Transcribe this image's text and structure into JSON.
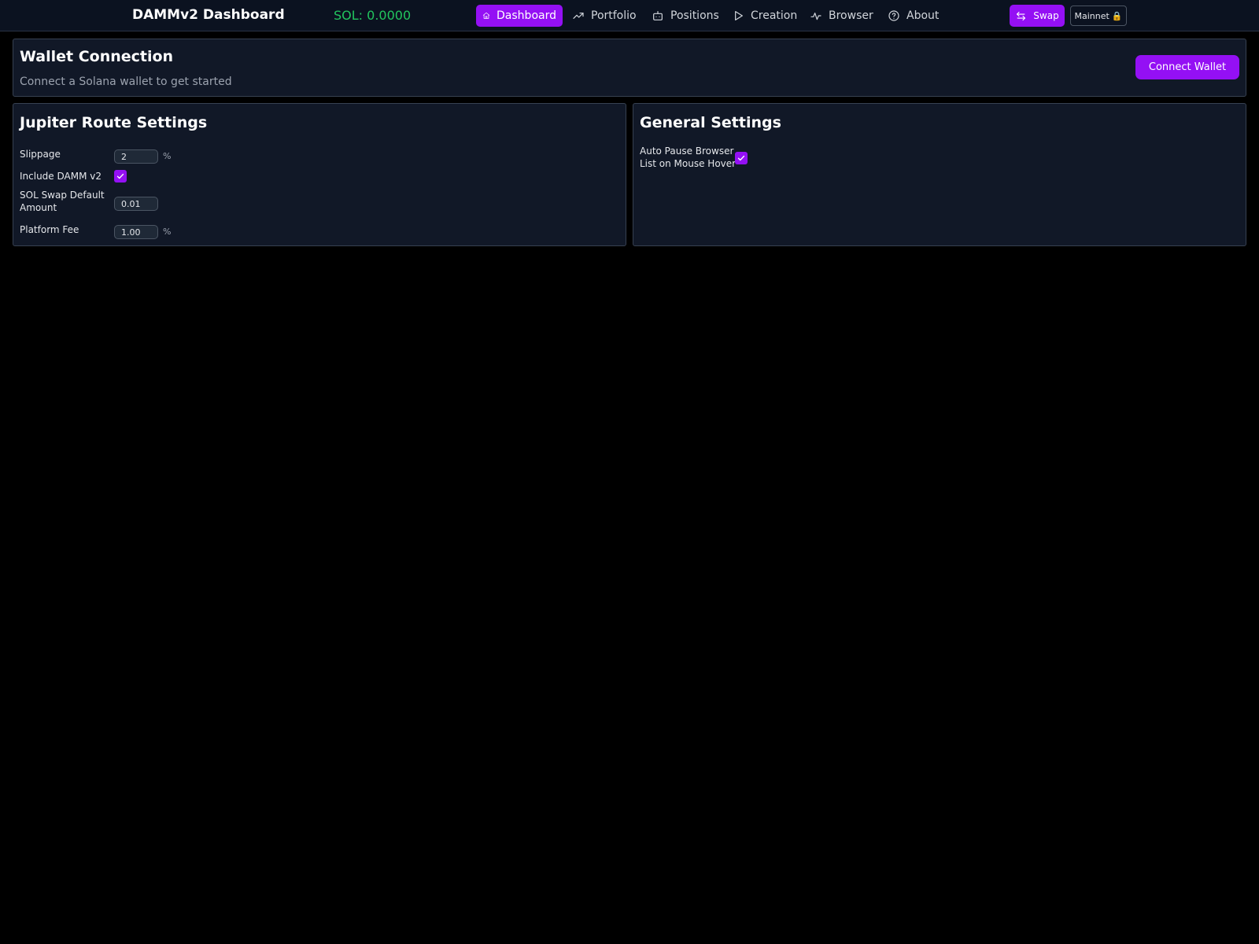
{
  "header": {
    "brand": "DAMMv2 Dashboard",
    "sol_balance": "SOL: 0.0000",
    "nav": {
      "dashboard": "Dashboard",
      "portfolio": "Portfolio",
      "positions": "Positions",
      "creation": "Creation",
      "browser": "Browser",
      "about": "About"
    },
    "swap_label": "Swap",
    "network_label": "Mainnet",
    "network_lock": "🔒"
  },
  "wallet": {
    "title": "Wallet Connection",
    "subtitle": "Connect a Solana wallet to get started",
    "connect_label": "Connect Wallet"
  },
  "jupiter": {
    "title": "Jupiter Route Settings",
    "slippage_label": "Slippage",
    "slippage_value": "2",
    "slippage_unit": "%",
    "include_damm_label": "Include DAMM v2",
    "include_damm_checked": true,
    "sol_swap_label_line1": "SOL Swap Default",
    "sol_swap_label_line2": "Amount",
    "sol_swap_value": "0.01",
    "platform_fee_label": "Platform Fee",
    "platform_fee_value": "1.00",
    "platform_fee_unit": "%"
  },
  "general": {
    "title": "General Settings",
    "auto_pause_line1": "Auto Pause Browser",
    "auto_pause_line2": "List on Mouse Hover",
    "auto_pause_checked": true
  },
  "colors": {
    "accent": "#9410f4",
    "balance_green": "#22c55e",
    "card_bg": "#111827",
    "page_bg": "#000000"
  }
}
